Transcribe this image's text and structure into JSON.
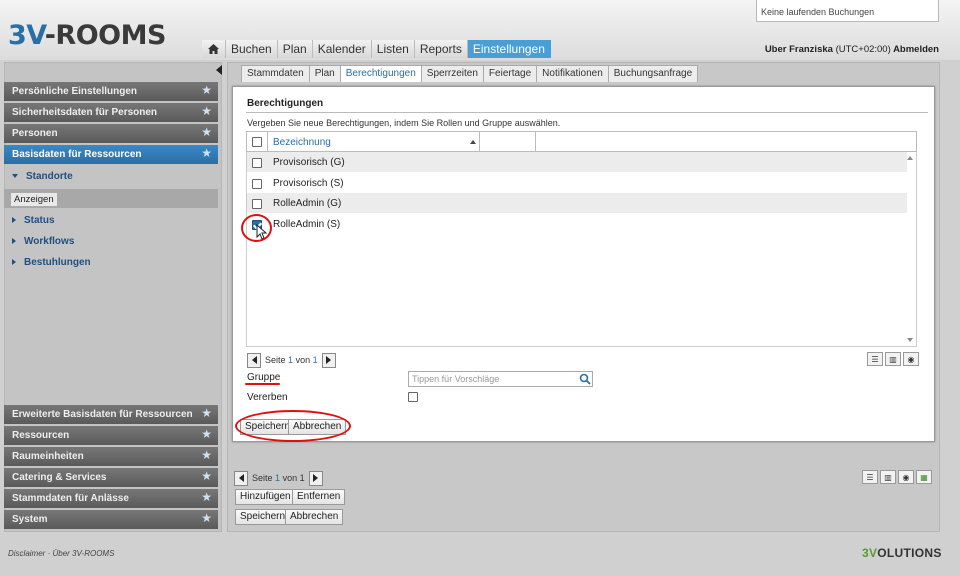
{
  "app": {
    "logo_prefix": "3V",
    "logo_suffix": "-ROOMS"
  },
  "notifications": {
    "text": "Keine laufenden Buchungen"
  },
  "topnav": {
    "home_icon": "home-icon",
    "items": [
      "Buchen",
      "Plan",
      "Kalender",
      "Listen",
      "Reports",
      "Einstellungen"
    ],
    "active": "Einstellungen"
  },
  "user": {
    "prefix": "Uber Franziska",
    "timezone": "(UTC+02:00)",
    "logout": "Abmelden"
  },
  "sidebar": {
    "top_items": [
      "Persönliche Einstellungen",
      "Sicherheitsdaten für Personen",
      "Personen",
      "Basisdaten für Ressourcen"
    ],
    "active_item": "Basisdaten für Ressourcen",
    "sub_items": [
      "Standorte",
      "Status",
      "Workflows",
      "Bestuhlungen"
    ],
    "action_button": "Anzeigen",
    "bottom_items": [
      "Erweiterte Basisdaten für Ressourcen",
      "Ressourcen",
      "Raumeinheiten",
      "Catering & Services",
      "Stammdaten für Anlässe",
      "System"
    ]
  },
  "subtabs": {
    "items": [
      "Stammdaten",
      "Plan",
      "Berechtigungen",
      "Sperrzeiten",
      "Feiertage",
      "Notifikationen",
      "Buchungsanfrage"
    ],
    "active": "Berechtigungen"
  },
  "dialog": {
    "title": "Berechtigungen",
    "intro": "Vergeben Sie neue Berechtigungen, indem Sie Rollen und Gruppe auswählen.",
    "grid": {
      "column_header": "Bezeichnung",
      "rows": [
        {
          "label": "Provisorisch (G)",
          "checked": false
        },
        {
          "label": "Provisorisch (S)",
          "checked": false
        },
        {
          "label": "RolleAdmin (G)",
          "checked": false
        },
        {
          "label": "RolleAdmin (S)",
          "checked": true
        }
      ]
    },
    "pager": {
      "page_label": "Seite",
      "current": "1",
      "of_label": "von",
      "total": "1"
    },
    "gruppe_label": "Gruppe",
    "gruppe_placeholder": "Tippen für Vorschläge",
    "vererben_label": "Vererben",
    "save_button": "Speichern",
    "cancel_button": "Abbrechen"
  },
  "background_panel": {
    "pager": {
      "page_label": "Seite",
      "current": "1",
      "of_label": "von",
      "total": "1"
    },
    "add_button": "Hinzufügen",
    "remove_button": "Entfernen",
    "save_button": "Speichern",
    "cancel_button": "Abbrechen"
  },
  "footer": {
    "disclaimer": "Disclaimer",
    "separator": "·",
    "about": "Über 3V-ROOMS",
    "brand_prefix": "3V",
    "brand_suffix": "OLUTIONS"
  },
  "colors": {
    "accent": "#2a6ea6",
    "active_tab": "#4a9ed6",
    "annotation_red": "#e01010"
  }
}
